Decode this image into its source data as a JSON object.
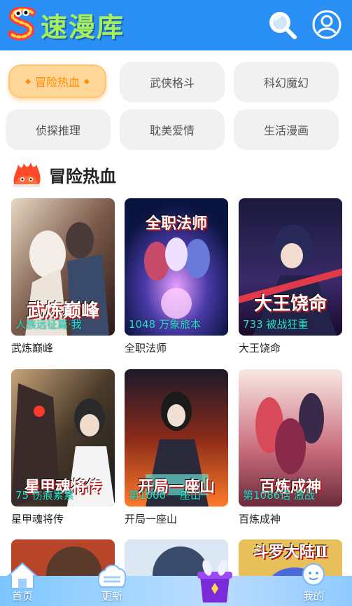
{
  "header": {
    "logo_text": "速漫库",
    "logo_mark": "S"
  },
  "categories": [
    {
      "label": "冒险热血",
      "active": true
    },
    {
      "label": "武侠格斗",
      "active": false
    },
    {
      "label": "科幻魔幻",
      "active": false
    },
    {
      "label": "侦探推理",
      "active": false
    },
    {
      "label": "耽美爱情",
      "active": false
    },
    {
      "label": "生活漫画",
      "active": false
    }
  ],
  "section": {
    "title": "冒险热血",
    "icon": "fire-mascot-icon"
  },
  "comics": [
    {
      "name": "武炼巅峰",
      "chapter": "人族远征篇·我",
      "art_title": "武炼巅峰"
    },
    {
      "name": "全职法师",
      "chapter": "1048 万象旅本",
      "art_title": "全职法师"
    },
    {
      "name": "大王饶命",
      "chapter": "733 被战狂重",
      "art_title": "大王饶命"
    },
    {
      "name": "星甲魂将传",
      "chapter": "75 伤痕累累",
      "art_title": "星甲魂将传"
    },
    {
      "name": "开局一座山",
      "chapter": "第1000 一座山",
      "art_title": "开局一座山"
    },
    {
      "name": "百炼成神",
      "chapter": "第1086话 激战",
      "art_title": "百炼成神"
    },
    {
      "name": "",
      "chapter": "",
      "art_title": ""
    },
    {
      "name": "",
      "chapter": "",
      "art_title": ""
    },
    {
      "name": "",
      "chapter": "",
      "art_title": "斗罗大陆Ⅱ"
    }
  ],
  "bottom_nav": [
    {
      "label": "首页",
      "icon": "home-icon"
    },
    {
      "label": "更新",
      "icon": "update-icon"
    },
    {
      "label": "",
      "icon": "magic-hat-icon"
    },
    {
      "label": "我的",
      "icon": "profile-icon"
    }
  ],
  "colors": {
    "header_bg": "#2a8ff5",
    "logo_text": "#a7f05a",
    "active_cat_bg": "#ffd79a",
    "active_cat_text": "#ff8a00",
    "chapter_text": "#23e3c9"
  }
}
